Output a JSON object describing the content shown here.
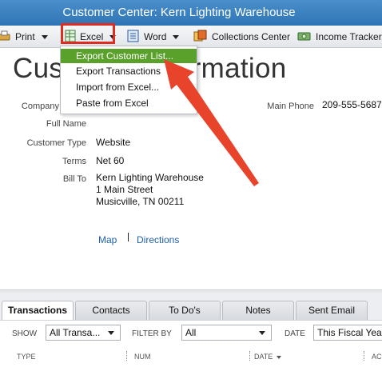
{
  "window": {
    "title": "Customer Center: Kern Lighting Warehouse"
  },
  "toolbar": {
    "print_label": "Print",
    "excel_label": "Excel",
    "word_label": "Word",
    "collections_label": "Collections Center",
    "income_label": "Income Tracker"
  },
  "excel_menu": {
    "items": [
      "Export Customer List...",
      "Export Transactions",
      "Import from Excel...",
      "Paste from Excel"
    ]
  },
  "customer": {
    "heading": "Customer Information",
    "company_label": "Company",
    "full_name_label": "Full Name",
    "type_label": "Customer Type",
    "type_value": "Website",
    "terms_label": "Terms",
    "terms_value": "Net 60",
    "bill_to_label": "Bill To",
    "bill_to_lines": [
      "Kern Lighting Warehouse",
      "1 Main Street",
      "Musicville, TN 00211"
    ],
    "phone_label": "Main Phone",
    "phone_value": "209-555-5687",
    "map_link": "Map",
    "directions_link": "Directions"
  },
  "tabs": [
    "Transactions",
    "Contacts",
    "To Do's",
    "Notes",
    "Sent Email"
  ],
  "filters": {
    "show_label": "SHOW",
    "show_value": "All Transa...",
    "filter_by_label": "FILTER BY",
    "filter_by_value": "All",
    "date_label": "DATE",
    "date_value": "This Fiscal Year"
  },
  "columns": [
    "TYPE",
    "NUM",
    "DATE",
    "AC"
  ],
  "colors": {
    "titlebar": "#3a80c0",
    "highlight": "#5aa12c",
    "callout": "#e8442b",
    "link": "#1f5fa8"
  },
  "icons": [
    "printer-icon",
    "excel-icon",
    "word-icon",
    "collections-icon",
    "income-tracker-icon",
    "arrow-pointer-icon"
  ]
}
